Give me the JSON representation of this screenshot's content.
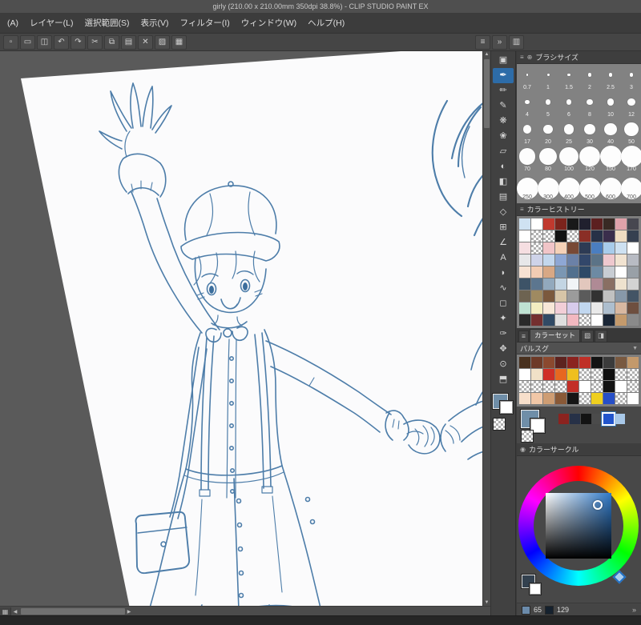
{
  "window": {
    "title": "girly (210.00 x 210.00mm 350dpi 38.8%)  - CLIP STUDIO PAINT EX"
  },
  "menubar": {
    "items": [
      "(A)",
      "レイヤー(L)",
      "選択範囲(S)",
      "表示(V)",
      "フィルター(I)",
      "ウィンドウ(W)",
      "ヘルプ(H)"
    ]
  },
  "toolbar": {
    "left_buttons": [
      {
        "name": "new-file-button",
        "glyph": "▫"
      },
      {
        "name": "open-file-button",
        "glyph": "▭"
      },
      {
        "name": "save-button",
        "glyph": "◫"
      },
      {
        "name": "undo-button",
        "glyph": "↶"
      },
      {
        "name": "redo-button",
        "glyph": "↷"
      },
      {
        "name": "cut-button",
        "glyph": "✂"
      },
      {
        "name": "copy-button",
        "glyph": "⧉"
      },
      {
        "name": "paste-button",
        "glyph": "▤"
      },
      {
        "name": "clear-button",
        "glyph": "✕"
      },
      {
        "name": "fill-button",
        "glyph": "▨"
      },
      {
        "name": "grid-button",
        "glyph": "▦"
      }
    ],
    "right_buttons": [
      {
        "name": "panel-menu-icon",
        "glyph": "≡"
      },
      {
        "name": "collapse-panels-icon",
        "glyph": "»"
      },
      {
        "name": "workspace-icon",
        "glyph": "▥"
      }
    ]
  },
  "tool_strip": {
    "main_color": "#6f8ea8",
    "sub_color": "#ffffff",
    "tools": [
      {
        "name": "operation-tool",
        "glyph": "▣"
      },
      {
        "name": "pen-tool",
        "glyph": "✒",
        "selected": true
      },
      {
        "name": "pencil-tool",
        "glyph": "✏"
      },
      {
        "name": "brush-tool",
        "glyph": "✎"
      },
      {
        "name": "airbrush-tool",
        "glyph": "❋"
      },
      {
        "name": "decoration-tool",
        "glyph": "❀"
      },
      {
        "name": "eraser-tool",
        "glyph": "▱"
      },
      {
        "name": "blend-tool",
        "glyph": "◐"
      },
      {
        "name": "fill-tool",
        "glyph": "◧"
      },
      {
        "name": "gradient-tool",
        "glyph": "▤"
      },
      {
        "name": "figure-tool",
        "glyph": "◇"
      },
      {
        "name": "frame-border-tool",
        "glyph": "⊞"
      },
      {
        "name": "ruler-tool",
        "glyph": "∠"
      },
      {
        "name": "text-tool",
        "glyph": "A"
      },
      {
        "name": "balloon-tool",
        "glyph": "◗"
      },
      {
        "name": "line-correction-tool",
        "glyph": "∿"
      },
      {
        "name": "selection-tool",
        "glyph": "◻"
      },
      {
        "name": "auto-select-tool",
        "glyph": "✦"
      },
      {
        "name": "eyedropper-tool",
        "glyph": "✑"
      },
      {
        "name": "move-tool",
        "glyph": "✥"
      },
      {
        "name": "zoom-tool",
        "glyph": "⊙"
      },
      {
        "name": "layer-move-tool",
        "glyph": "⬒"
      }
    ]
  },
  "right_panel": {
    "brush_size": {
      "title": "ブラシサイズ",
      "sizes": [
        0.7,
        1,
        1.5,
        2,
        2.5,
        3,
        4,
        5,
        6,
        8,
        10,
        12,
        17,
        20,
        25,
        30,
        40,
        50,
        70,
        80,
        100,
        120,
        150,
        170,
        250,
        300,
        400,
        500,
        600,
        700
      ]
    },
    "color_history": {
      "title": "カラーヒストリー",
      "swatches": [
        "#cfe2f2",
        "#ffffff",
        "#c0392e",
        "#7c241c",
        "#191919",
        "#20202e",
        "#5c2020",
        "#382a24",
        "#e0a2aa",
        "#474750",
        "#ffffff",
        "checker",
        "checker",
        "#121212",
        "checker",
        "#8a2e26",
        "#273147",
        "#3a2e4c",
        "#efdcc1",
        "#364050",
        "#f5dee1",
        "checker",
        "#f1c5c8",
        "#f5d1b7",
        "#784935",
        "#2d3b54",
        "#4a7ec0",
        "#a8cceb",
        "#cee1f1",
        "#ffffff",
        "#e7e7e9",
        "#ced3e9",
        "#c3d7ed",
        "#8ea7d4",
        "#6b81a7",
        "#32476a",
        "#5b7387",
        "#eec8ce",
        "#f1e3d1",
        "#b8bbc3",
        "#f7e2d3",
        "#f2ccb3",
        "#d8a885",
        "#7b97b3",
        "#52708e",
        "#2e4967",
        "#6d8aa3",
        "#c8cdd3",
        "#ffffff",
        "#99a0a7",
        "#3d5367",
        "#5c768f",
        "#92a9bd",
        "#c3d5e3",
        "#f1f4f7",
        "#e2c7bd",
        "#af8a95",
        "#896f63",
        "#eee2ce",
        "#d3d3d3",
        "#6d6351",
        "#9f8a61",
        "#7b593d",
        "#d7c5a7",
        "#9b9b9b",
        "#5b5b5b",
        "#323232",
        "#c1c1c1",
        "#8798a9",
        "#435465",
        "#bee2d2",
        "#f3edc1",
        "#f7e7d7",
        "#f2ced7",
        "#d7cbeb",
        "#c1d7ef",
        "#e9e9e9",
        "#adbece",
        "#d8b8a1",
        "#6e4f3f",
        "#2a2a2a",
        "#742f2f",
        "#314a65",
        "#dfdfdf",
        "#f2b8c0",
        "checker",
        "#ffffff",
        "#1a2636",
        "#c49a6c",
        "#8a8a8a"
      ]
    },
    "color_set": {
      "tab_label": "カラーセット",
      "palette_name": "パルスグ",
      "swatches": [
        "#49311f",
        "#6d3a27",
        "#8b492f",
        "#5d231f",
        "#8b231f",
        "#bf2f27",
        "#131313",
        "#3b3b3b",
        "#795940",
        "#c3996b",
        "#ffffff",
        "#f1e1c7",
        "#cf2f27",
        "#e76720",
        "#efbf1f",
        "checker",
        "checker",
        "#0f0f0f",
        "checker",
        "checker",
        "checker",
        "checker",
        "checker",
        "checker",
        "#c32f27",
        "#ffffff",
        "checker",
        "#131313",
        "#ffffff",
        "checker",
        "#f7dfcb",
        "#f1c7a7",
        "#ce9d73",
        "#895937",
        "#151515",
        "checker",
        "#efcf1f",
        "#274fc7",
        "checker",
        "#ffffff"
      ],
      "extra_swatches": [
        "#8b231f",
        "#273147",
        "#131313",
        "#4b4b4b",
        "#2255cc",
        "#a8c8e8"
      ],
      "selected_extra_index": 4,
      "main_color": "#6f8ea8",
      "sub_color": "#ffffff"
    },
    "color_circle": {
      "title": "カラーサークル",
      "picker_color": "#2f79c8",
      "selected_color": "#33414f",
      "sub_color": "#ffffff",
      "values": [
        {
          "label": "65",
          "chip": "#6b8bab"
        },
        {
          "label": "129",
          "chip": "#15212e"
        }
      ]
    }
  }
}
